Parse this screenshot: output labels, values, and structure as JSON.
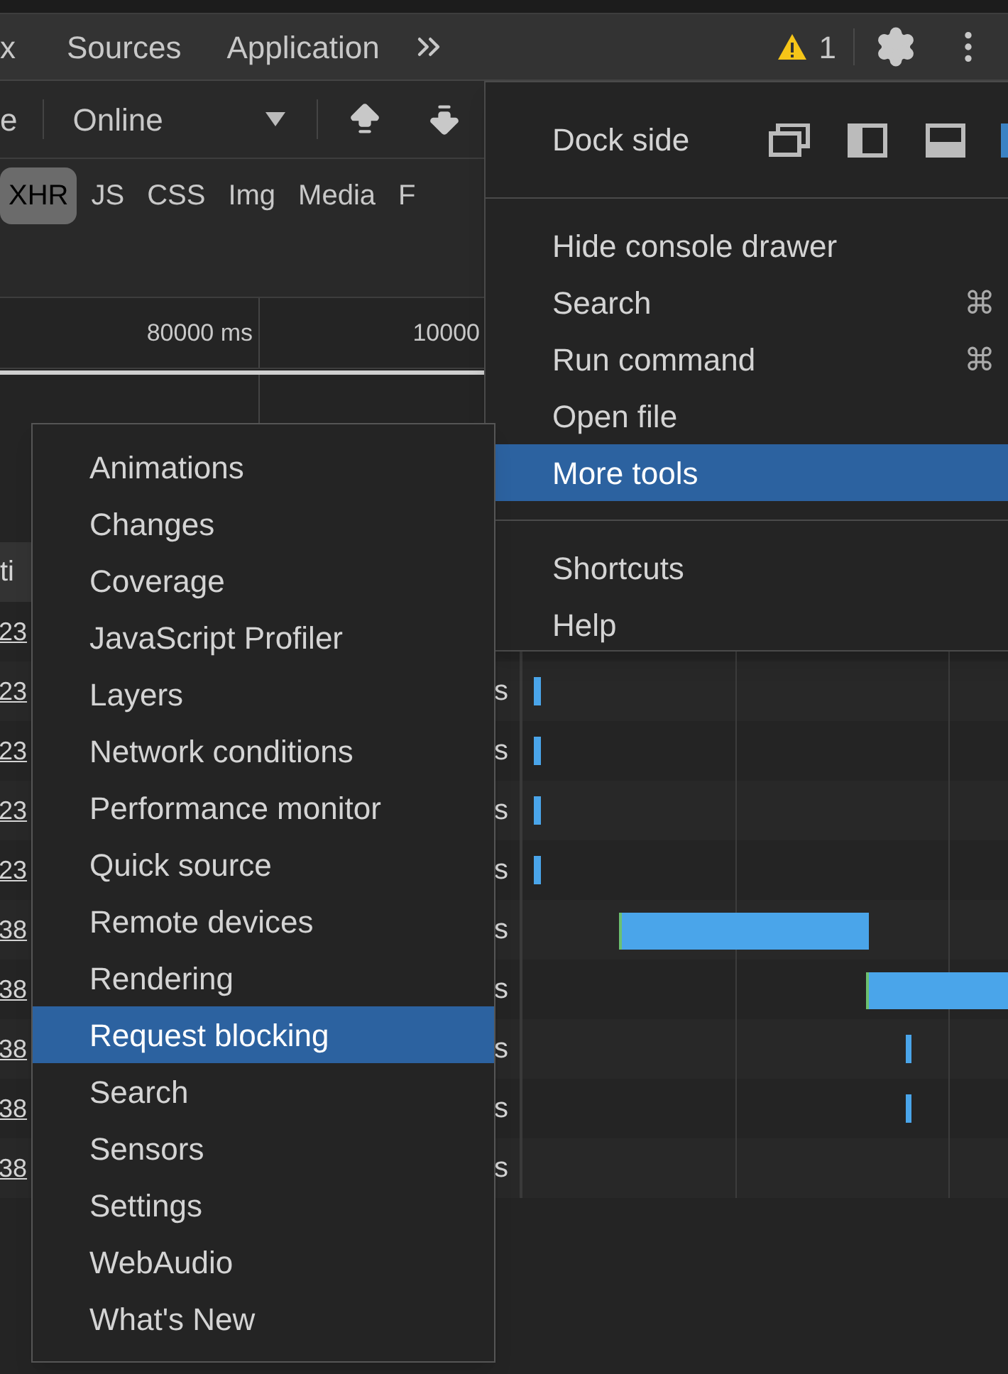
{
  "tabs": [
    {
      "label": "x",
      "selected": false
    },
    {
      "label": "Sources",
      "selected": false
    },
    {
      "label": "Application",
      "selected": false
    }
  ],
  "warnings": {
    "count": "1"
  },
  "toolbar": {
    "fragment": "e",
    "throttling": "Online"
  },
  "filters": [
    {
      "label": "XHR",
      "selected": true
    },
    {
      "label": "JS",
      "selected": false
    },
    {
      "label": "CSS",
      "selected": false
    },
    {
      "label": "Img",
      "selected": false
    },
    {
      "label": "Media",
      "selected": false
    },
    {
      "label": "F",
      "selected": false
    }
  ],
  "timeline": {
    "ticks": [
      "80000 ms",
      "10000"
    ]
  },
  "table": {
    "header": "ti",
    "rows": [
      {
        "name": "23"
      },
      {
        "name": "23",
        "time": "s"
      },
      {
        "name": "23",
        "time": "s"
      },
      {
        "name": "23",
        "time": "s"
      },
      {
        "name": "23",
        "time": "s"
      },
      {
        "name": "38",
        "time": "s"
      },
      {
        "name": "38",
        "time": "s"
      },
      {
        "name": "38",
        "time": "s"
      },
      {
        "name": "38",
        "time": "s"
      },
      {
        "name": "38",
        "time": "s"
      }
    ]
  },
  "main_menu": {
    "dock_side": "Dock side",
    "groups": [
      [
        {
          "label": "Hide console drawer",
          "selected": false
        },
        {
          "label": "Search",
          "shortcut": "⌘",
          "selected": false
        },
        {
          "label": "Run command",
          "shortcut": "⌘",
          "selected": false
        },
        {
          "label": "Open file",
          "selected": false
        },
        {
          "label": "More tools",
          "selected": true
        }
      ],
      [
        {
          "label": "Shortcuts",
          "selected": false
        },
        {
          "label": "Help",
          "selected": false
        }
      ]
    ]
  },
  "submenu": {
    "items": [
      {
        "label": "Animations",
        "selected": false
      },
      {
        "label": "Changes",
        "selected": false
      },
      {
        "label": "Coverage",
        "selected": false
      },
      {
        "label": "JavaScript Profiler",
        "selected": false
      },
      {
        "label": "Layers",
        "selected": false
      },
      {
        "label": "Network conditions",
        "selected": false
      },
      {
        "label": "Performance monitor",
        "selected": false
      },
      {
        "label": "Quick source",
        "selected": false
      },
      {
        "label": "Remote devices",
        "selected": false
      },
      {
        "label": "Rendering",
        "selected": false
      },
      {
        "label": "Request blocking",
        "selected": true
      },
      {
        "label": "Search",
        "selected": false
      },
      {
        "label": "Sensors",
        "selected": false
      },
      {
        "label": "Settings",
        "selected": false
      },
      {
        "label": "WebAudio",
        "selected": false
      },
      {
        "label": "What's New",
        "selected": false
      }
    ]
  }
}
